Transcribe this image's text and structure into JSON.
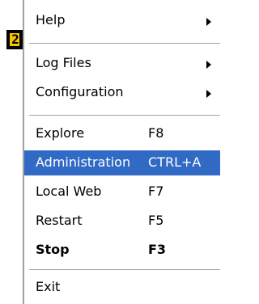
{
  "badge": {
    "text": "2",
    "color": "#f5c400"
  },
  "menu": {
    "items": [
      {
        "label": "Help",
        "has_submenu": true
      },
      {
        "label": "Log Files",
        "has_submenu": true
      },
      {
        "label": "Configuration",
        "has_submenu": true
      },
      {
        "label": "Explore",
        "shortcut": "F8"
      },
      {
        "label": "Administration",
        "shortcut": "CTRL+A",
        "selected": true
      },
      {
        "label": "Local Web",
        "shortcut": "F7"
      },
      {
        "label": "Restart",
        "shortcut": "F5"
      },
      {
        "label": "Stop",
        "shortcut": "F3",
        "bold": true
      },
      {
        "label": "Exit"
      }
    ],
    "selection_color": "#316ac5"
  }
}
